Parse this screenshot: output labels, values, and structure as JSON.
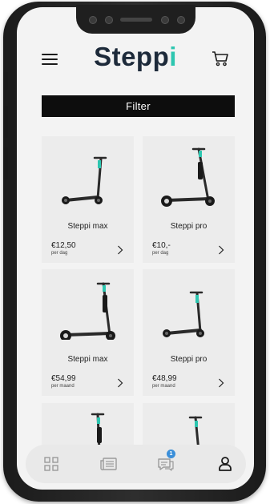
{
  "header": {
    "logo_main": "Stepp",
    "logo_accent": "i",
    "logo_accent_color": "#2dc6b0",
    "logo_color": "#1d2a3a"
  },
  "filter": {
    "label": "Filter"
  },
  "products": [
    {
      "name": "Steppi max",
      "price": "€12,50",
      "unit": "per dag"
    },
    {
      "name": "Steppi pro",
      "price": "€10,-",
      "unit": "per dag"
    },
    {
      "name": "Steppi max",
      "price": "€54,99",
      "unit": "per maand"
    },
    {
      "name": "Steppi pro",
      "price": "€48,99",
      "unit": "per maand"
    }
  ],
  "bottom_nav": {
    "items": [
      "grid-icon",
      "news-icon",
      "chat-icon",
      "user-icon"
    ],
    "chat_badge": "1",
    "badge_color": "#3b8fd9"
  },
  "colors": {
    "accent": "#2dc6b0",
    "filter_bg": "#0d0d0d"
  }
}
